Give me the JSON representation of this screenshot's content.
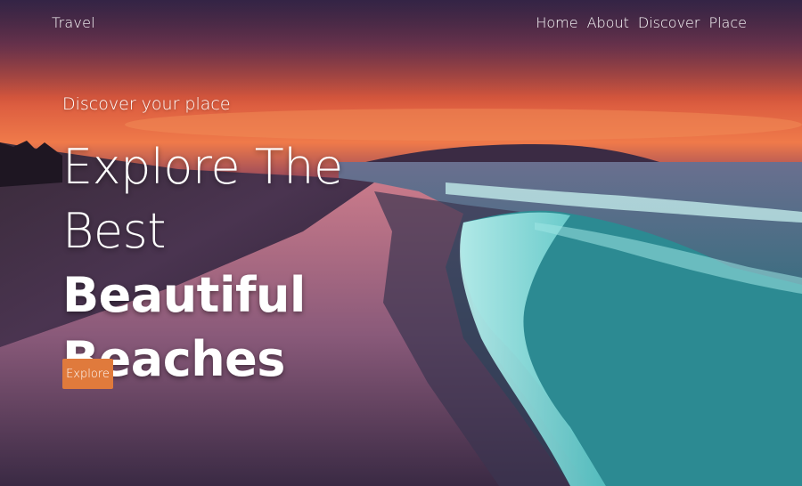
{
  "brand": {
    "name": "Travel"
  },
  "nav": {
    "items": [
      {
        "label": "Home"
      },
      {
        "label": "About"
      },
      {
        "label": "Discover"
      },
      {
        "label": "Place"
      }
    ]
  },
  "hero": {
    "subtitle": "Discover your place",
    "headline_line1": "Explore The",
    "headline_line2_light": "Best ",
    "headline_line2_bold": "Beautiful",
    "headline_line3_bold": "Beaches",
    "cta_label": "Explore"
  },
  "colors": {
    "accent": "#e07a3c",
    "text": "#ffffff"
  }
}
